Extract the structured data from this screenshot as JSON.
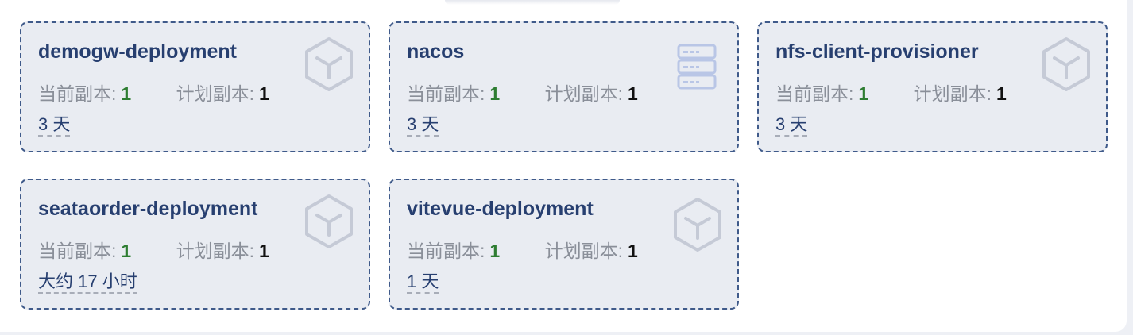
{
  "labels": {
    "current": "当前副本:",
    "planned": "计划副本:"
  },
  "colors": {
    "current_value": "#2e7d32",
    "name": "#273f70",
    "icon": "#c5cad6"
  },
  "deployments": [
    {
      "name": "demogw-deployment",
      "current": "1",
      "planned": "1",
      "age": "3 天",
      "icon": "cube-icon"
    },
    {
      "name": "nacos",
      "current": "1",
      "planned": "1",
      "age": "3 天",
      "icon": "server-icon"
    },
    {
      "name": "nfs-client-provisioner",
      "current": "1",
      "planned": "1",
      "age": "3 天",
      "icon": "cube-icon"
    },
    {
      "name": "seataorder-deployment",
      "current": "1",
      "planned": "1",
      "age": "大约 17 小时",
      "icon": "cube-icon"
    },
    {
      "name": "vitevue-deployment",
      "current": "1",
      "planned": "1",
      "age": "1 天",
      "icon": "cube-icon"
    }
  ]
}
